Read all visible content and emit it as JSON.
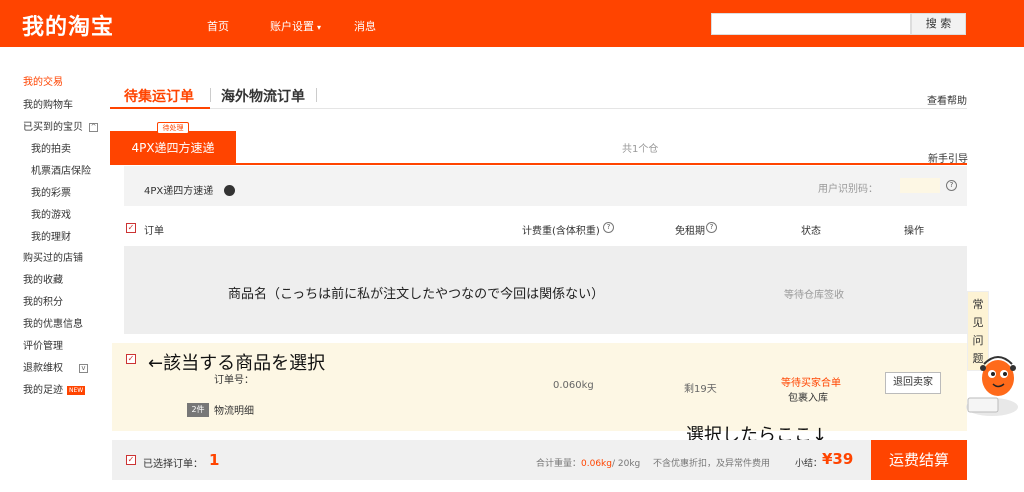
{
  "header": {
    "logo": "我的淘宝",
    "nav": [
      {
        "label": "首页"
      },
      {
        "label": "账户设置",
        "dropdown": true
      },
      {
        "label": "消息"
      }
    ],
    "search": {
      "value": "",
      "placeholder": "",
      "button": "搜 索"
    }
  },
  "sidebar": {
    "items": [
      {
        "label": "我的交易",
        "active": true
      },
      {
        "label": "我的购物车"
      },
      {
        "label": "已买到的宝贝",
        "toggle": "^"
      },
      {
        "label": "我的拍卖",
        "sub": true
      },
      {
        "label": "机票酒店保险",
        "sub": true
      },
      {
        "label": "我的彩票",
        "sub": true
      },
      {
        "label": "我的游戏",
        "sub": true
      },
      {
        "label": "我的理财",
        "sub": true
      },
      {
        "label": "购买过的店铺"
      },
      {
        "label": "我的收藏"
      },
      {
        "label": "我的积分"
      },
      {
        "label": "我的优惠信息"
      },
      {
        "label": "评价管理"
      },
      {
        "label": "退款维权",
        "toggle": "v"
      },
      {
        "label": "我的足迹",
        "badge": "NEW"
      }
    ]
  },
  "tabs": {
    "active": "待集运订单",
    "other": "海外物流订单",
    "help": "查看帮助"
  },
  "carrier_tab": {
    "label": "4PX递四方速递",
    "badge": "待处理",
    "count": "共1个仓",
    "guide": "新手引导"
  },
  "carrier_row": {
    "name": "4PX递四方速递",
    "user_code_label": "用户识别码："
  },
  "columns": {
    "order": "订单",
    "weight": "计费重(含体积重)",
    "free_period": "免租期",
    "status": "状态",
    "action": "操作"
  },
  "item1": {
    "name": "商品名（こっちは前に私が注文したやつなので今回は関係ない）",
    "status": "等待仓库签收"
  },
  "item2": {
    "annotation": "←該当する商品を選択",
    "order_no_label": "订单号：",
    "weight": "0.060kg",
    "days": "剩19天",
    "status_line1": "等待买家合单",
    "status_line2": "包裹入库",
    "return_button": "退回卖家",
    "qty": "2件",
    "logistics": "物流明细"
  },
  "footer": {
    "annotation": "選択したらここ↓",
    "selected_label": "已选择订单：",
    "selected_count": "1",
    "total_weight_label": "合计重量：",
    "total_weight_value": "0.06kg",
    "total_weight_limit": "/ 20kg",
    "no_discount": "不含优惠折扣，及异常件费用",
    "subtotal_label": "小结：",
    "subtotal_value": "¥39",
    "checkout_button": "运费结算"
  },
  "faq": {
    "label": "常见问题"
  }
}
